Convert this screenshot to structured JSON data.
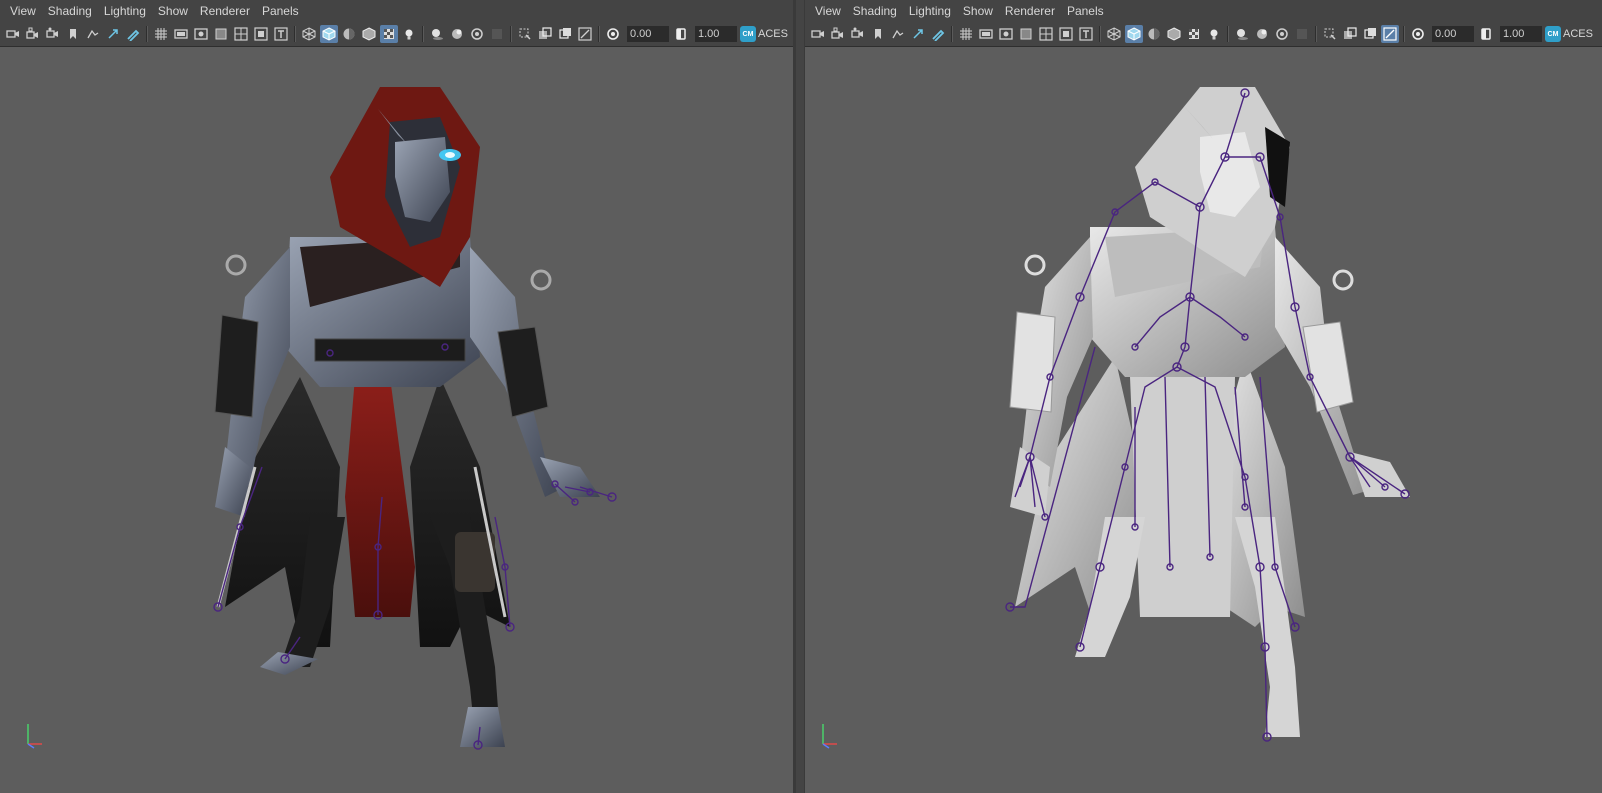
{
  "menus": [
    "View",
    "Shading",
    "Lighting",
    "Show",
    "Renderer",
    "Panels"
  ],
  "left_panel": {
    "menu": [
      "View",
      "Shading",
      "Lighting",
      "Show",
      "Renderer",
      "Panels"
    ],
    "exposure_value": "0.00",
    "gamma_value": "1.00",
    "color_space": "ACES",
    "shading_mode": "textured"
  },
  "right_panel": {
    "menu": [
      "View",
      "Shading",
      "Lighting",
      "Show",
      "Renderer",
      "Panels"
    ],
    "exposure_value": "0.00",
    "gamma_value": "1.00",
    "color_space": "ACES",
    "shading_mode": "default-material with skeleton"
  },
  "toolbar_icons": [
    "camera-select-icon",
    "camera-lock-icon",
    "camera-attributes-icon",
    "bookmark-icon",
    "image-plane-icon",
    "2d-pan-zoom-icon",
    "grease-pencil-icon",
    "grid-icon",
    "film-gate-icon",
    "resolution-gate-icon",
    "gate-mask-icon",
    "field-chart-icon",
    "safe-action-icon",
    "safe-title-icon",
    "wireframe-icon",
    "smooth-shade-icon",
    "default-material-icon",
    "wireframe-on-shaded-icon",
    "textured-icon",
    "use-all-lights-icon",
    "shadows-icon",
    "screen-space-ao-icon",
    "motion-blur-icon",
    "anti-aliasing-icon",
    "depth-of-field-icon",
    "isolate-select-icon",
    "xray-icon",
    "xray-joints-icon",
    "backface-culling-icon",
    "exposure-icon",
    "gamma-icon",
    "color-management-icon"
  ],
  "colors": {
    "viewport_bg": "#5d5d5d",
    "toolbar_bg": "#444444",
    "joint_color": "#4a2580",
    "hood_red": "#7a1a16",
    "eye_glow": "#3fd0ff"
  }
}
